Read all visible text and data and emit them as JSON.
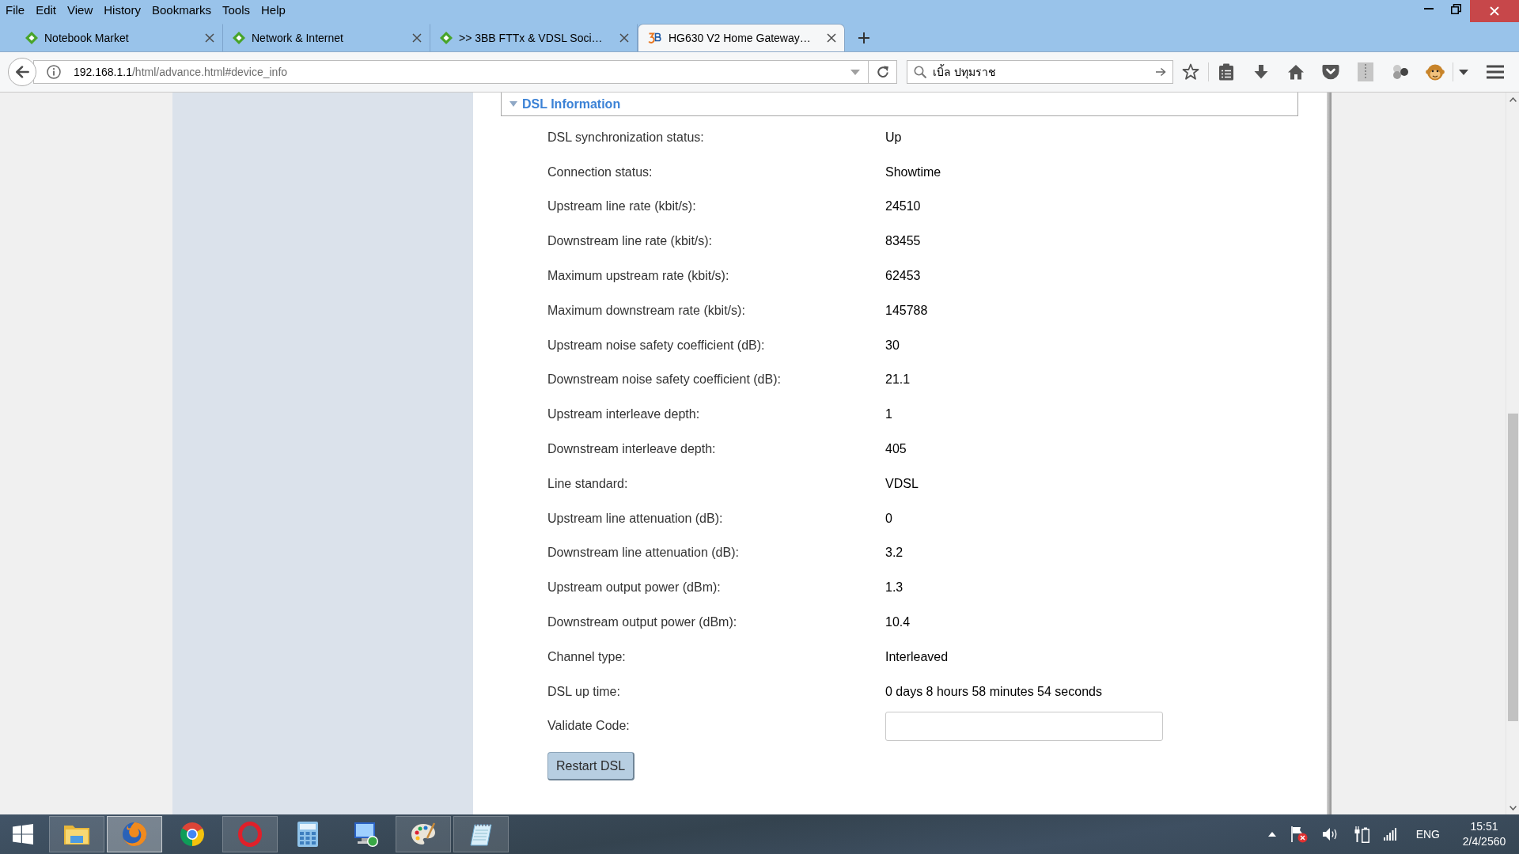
{
  "menu_bar": [
    "File",
    "Edit",
    "View",
    "History",
    "Bookmarks",
    "Tools",
    "Help"
  ],
  "tabs": [
    {
      "title": "Notebook Market",
      "kind": "diamond",
      "selected": false
    },
    {
      "title": "Network & Internet",
      "kind": "diamond",
      "selected": false
    },
    {
      "title": ">> 3BB FTTx & VDSL Soci…",
      "kind": "diamond",
      "selected": false
    },
    {
      "title": "HG630 V2 Home Gateway…",
      "kind": "logo",
      "selected": true
    }
  ],
  "address_bar": {
    "host": "192.168.1.1",
    "path": "/html/advance.html#device_info"
  },
  "search": {
    "value": "เบิ้ล ปทุมราช"
  },
  "section": {
    "title": "DSL Information",
    "expanded": true
  },
  "rows": [
    {
      "label": "DSL synchronization status:",
      "value": "Up"
    },
    {
      "label": "Connection status:",
      "value": "Showtime"
    },
    {
      "label": "Upstream line rate (kbit/s):",
      "value": "24510"
    },
    {
      "label": "Downstream line rate (kbit/s):",
      "value": "83455"
    },
    {
      "label": "Maximum upstream rate (kbit/s):",
      "value": "62453"
    },
    {
      "label": "Maximum downstream rate (kbit/s):",
      "value": "145788"
    },
    {
      "label": "Upstream noise safety coefficient (dB):",
      "value": "30"
    },
    {
      "label": "Downstream noise safety coefficient (dB):",
      "value": "21.1"
    },
    {
      "label": "Upstream interleave depth:",
      "value": "1"
    },
    {
      "label": "Downstream interleave depth:",
      "value": "405"
    },
    {
      "label": "Line standard:",
      "value": "VDSL"
    },
    {
      "label": "Upstream line attenuation (dB):",
      "value": "0"
    },
    {
      "label": "Downstream line attenuation (dB):",
      "value": "3.2"
    },
    {
      "label": "Upstream output power (dBm):",
      "value": "1.3"
    },
    {
      "label": "Downstream output power (dBm):",
      "value": "10.4"
    },
    {
      "label": "Channel type:",
      "value": "Interleaved"
    },
    {
      "label": "DSL up time:",
      "value": "0 days 8 hours 58 minutes 54 seconds"
    }
  ],
  "validate_code": {
    "label": "Validate Code:"
  },
  "restart_button": "Restart DSL",
  "taskbar": {
    "apps": [
      {
        "kind": "explorer",
        "running": true,
        "selected": false
      },
      {
        "kind": "firefox",
        "running": true,
        "selected": true
      },
      {
        "kind": "chrome",
        "running": false,
        "selected": false
      },
      {
        "kind": "opera",
        "running": true,
        "selected": false
      },
      {
        "kind": "calculator",
        "running": false,
        "selected": false
      },
      {
        "kind": "remote",
        "running": false,
        "selected": false
      },
      {
        "kind": "paint",
        "running": true,
        "selected": false
      },
      {
        "kind": "notepad",
        "running": true,
        "selected": false
      }
    ],
    "language": "ENG",
    "time": "15:51",
    "date": "2/4/2560"
  }
}
